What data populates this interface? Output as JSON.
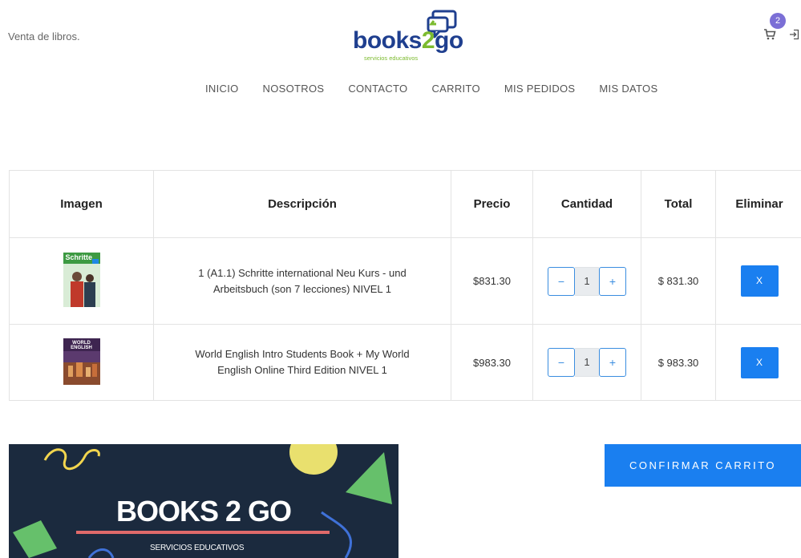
{
  "header": {
    "tagline": "Venta de libros.",
    "logo": {
      "word_books": "books",
      "word_two": "2",
      "word_go": "go",
      "subtitle": "servicios educativos"
    },
    "cart_count": "2",
    "cart_icon": "cart-icon",
    "logout_icon": "logout-icon"
  },
  "nav": [
    "INICIO",
    "NOSOTROS",
    "CONTACTO",
    "CARRITO",
    "MIS PEDIDOS",
    "MIS DATOS"
  ],
  "table": {
    "headers": [
      "Imagen",
      "Descripción",
      "Precio",
      "Cantidad",
      "Total",
      "Eliminar"
    ],
    "rows": [
      {
        "cover_title": "Schritte",
        "description_line1": "1 (A1.1) Schritte international Neu Kurs - und",
        "description_line2": "Arbeitsbuch (son 7 lecciones) NIVEL 1",
        "price": "$831.30",
        "qty_minus": "−",
        "quantity": "1",
        "qty_plus": "+",
        "total": "$ 831.30",
        "delete_label": "X"
      },
      {
        "cover_title": "WORLD ENGLISH",
        "description_line1": "World English Intro Students Book + My World",
        "description_line2": "English Online Third Edition NIVEL 1",
        "price": "$983.30",
        "qty_minus": "−",
        "quantity": "1",
        "qty_plus": "+",
        "total": "$ 983.30",
        "delete_label": "X"
      }
    ]
  },
  "promo": {
    "brand": "BOOKS 2 GO",
    "subtitle": "SERVICIOS EDUCATIVOS"
  },
  "confirm_label": "CONFIRMAR CARRITO",
  "colors": {
    "primary": "#1a7ff0",
    "logo_blue": "#1f3f8f",
    "logo_green": "#7cbb2f",
    "badge": "#7b6fd6",
    "promo_bg": "#1b2a3e"
  }
}
